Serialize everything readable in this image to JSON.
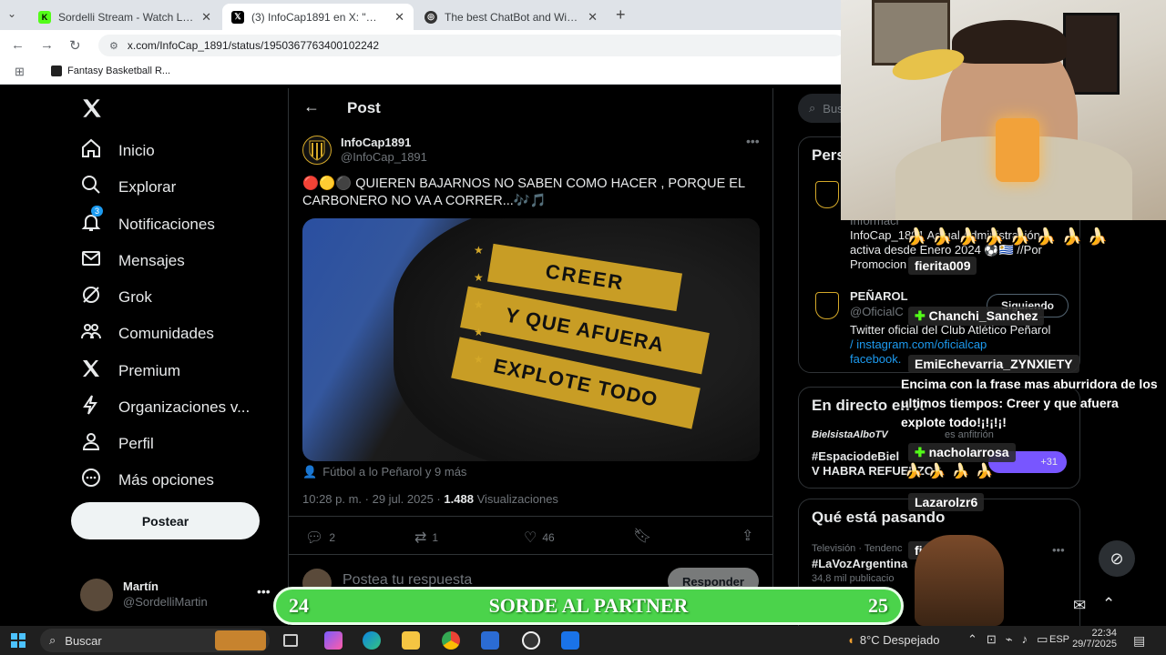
{
  "browser": {
    "tabs": [
      {
        "title": "Sordelli Stream - Watch Live on",
        "favicon": "kick-icon"
      },
      {
        "title": "(3) InfoCap1891 en X: \"🔴🟡⚫",
        "favicon": "x-icon"
      },
      {
        "title": "The best ChatBot and Widgets",
        "favicon": "chatbot-icon"
      }
    ],
    "url": "x.com/InfoCap_1891/status/1950367763400102242",
    "bookmark": "Fantasy Basketball R..."
  },
  "sidebar": {
    "items": [
      {
        "label": "Inicio",
        "icon": "home-icon"
      },
      {
        "label": "Explorar",
        "icon": "search-icon"
      },
      {
        "label": "Notificaciones",
        "icon": "bell-icon",
        "badge": "3"
      },
      {
        "label": "Mensajes",
        "icon": "mail-icon"
      },
      {
        "label": "Grok",
        "icon": "grok-icon"
      },
      {
        "label": "Comunidades",
        "icon": "people-icon"
      },
      {
        "label": "Premium",
        "icon": "x-icon"
      },
      {
        "label": "Organizaciones v...",
        "icon": "bolt-icon"
      },
      {
        "label": "Perfil",
        "icon": "person-icon"
      },
      {
        "label": "Más opciones",
        "icon": "more-circle-icon"
      }
    ],
    "post_button": "Postear",
    "account": {
      "name": "Martín",
      "handle": "@SordelliMartin"
    }
  },
  "post": {
    "header": "Post",
    "author_name": "InfoCap1891",
    "author_handle": "@InfoCap_1891",
    "text": "🔴🟡⚫ QUIEREN BAJARNOS NO SABEN COMO HACER , PORQUE EL CARBONERO NO VA A CORRER...🎶🎵",
    "armband_lines": [
      "CREER",
      "Y QUE AFUERA",
      "EXPLOTE TODO"
    ],
    "tagged": "Fútbol a lo Peñarol y 9 más",
    "time": "10:28 p. m. · 29 jul. 2025 ·",
    "views_count": "1.488",
    "views_label": "Visualizaciones",
    "replies": "2",
    "reposts": "1",
    "likes": "46",
    "reply_placeholder": "Postea tu respuesta",
    "reply_button": "Responder"
  },
  "right": {
    "search_partial": "Bus",
    "persons_partial": "Pers",
    "user1_bio_lines": [
      "Informaci",
      "InfoCap_1891 Actual Administración",
      "activa desde Enero 2024 ⚽🇺🇾 //Por",
      "Promocion"
    ],
    "user2_name": "PEÑAROL",
    "user2_handle": "@OficialC",
    "user2_bio_lines": [
      "Twitter oficial del Club Atlético Peñarol",
      "/ instagram.com/oficialcap",
      "facebook."
    ],
    "following_button": "Siguiendo",
    "live_title": "En directo en X",
    "live_host": "BielsistaAlboTV",
    "live_host_role": "es anfitrión",
    "live_title_lines": [
      "#EspaciodeBiel",
      "V HABRA REFUERZOS"
    ],
    "live_count": "+31",
    "trends_title": "Qué está pasando",
    "trend_category": "Televisión · Tendenc",
    "trend_name": "#LaVozArgentina",
    "trend_posts": "34,8 mil publicacio"
  },
  "chat": [
    {
      "user": "fierita009",
      "message": ""
    },
    {
      "user": "Chanchi_Sanchez",
      "message": ""
    },
    {
      "user": "EmiEchevarria_ZYNXIETY",
      "message": "Encima con la frase mas aburridora de los ultimos tiempos: Creer y que afuera explote todo!¡!¡!¡!"
    },
    {
      "user": "nacholarrosa",
      "message": ""
    },
    {
      "user": "Lazarolzr6",
      "message": ""
    },
    {
      "user": "fierita009",
      "message": ""
    }
  ],
  "banner": {
    "left_number": "24",
    "text": "SORDE AL PARTNER",
    "right_number": "25"
  },
  "taskbar": {
    "search_label": "Buscar",
    "weather": "8°C  Despejado",
    "language": "ESP",
    "time": "22:34",
    "date": "29/7/2025"
  },
  "colors": {
    "accent": "#1d9bf0",
    "banner": "#4bd34b",
    "gold": "#d4a829"
  }
}
